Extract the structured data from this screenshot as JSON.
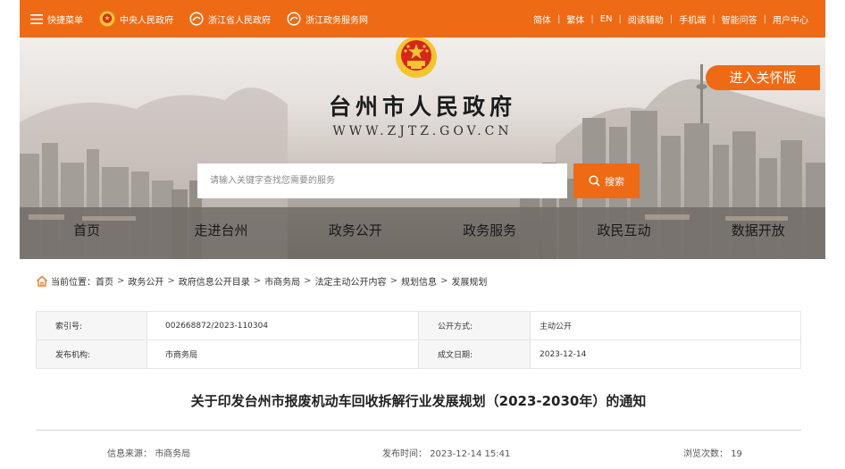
{
  "topbar": {
    "left_items": [
      {
        "icon": "menu-icon",
        "label": "快捷菜单"
      },
      {
        "icon": "national-emblem-icon",
        "label": "中央人民政府"
      },
      {
        "icon": "zhejiang-logo-icon",
        "label": "浙江省人民政府"
      },
      {
        "icon": "zhejiang-logo-icon",
        "label": "浙江政务服务网"
      }
    ],
    "right_links": [
      "简体",
      "繁体",
      "EN",
      "阅读辅助",
      "手机端",
      "智能问答",
      "用户中心"
    ],
    "separator": "|"
  },
  "banner": {
    "title": "台州市人民政府",
    "domain": "WWW.ZJTZ.GOV.CN",
    "care_button": "进入关怀版"
  },
  "search": {
    "placeholder": "请输入关键字查找您需要的服务",
    "button_label": "搜索"
  },
  "nav": [
    "首页",
    "走进台州",
    "政务公开",
    "政务服务",
    "政民互动",
    "数据开放"
  ],
  "breadcrumb": {
    "prefix": "当前位置：",
    "items": [
      "首页",
      "政务公开",
      "政府信息公开目录",
      "市商务局",
      "法定主动公开内容",
      "规划信息",
      "发展规划"
    ],
    "arrow": ">"
  },
  "info": {
    "index_label": "索引号:",
    "index_value": "002668872/2023-110304",
    "method_label": "公开方式:",
    "method_value": "主动公开",
    "issuer_label": "发布机构:",
    "issuer_value": "市商务局",
    "date_label": "成文日期:",
    "date_value": "2023-12-14"
  },
  "article": {
    "title": "关于印发台州市报废机动车回收拆解行业发展规划（2023-2030年）的通知",
    "source_label": "信息来源：",
    "source_value": "市商务局",
    "time_label": "发布时间：",
    "time_value": "2023-12-14 15:41",
    "views_label": "浏览次数：",
    "views_value": "19"
  },
  "colors": {
    "accent": "#ef6a14",
    "emblem_red": "#d7261b",
    "emblem_gold": "#f4c531"
  }
}
